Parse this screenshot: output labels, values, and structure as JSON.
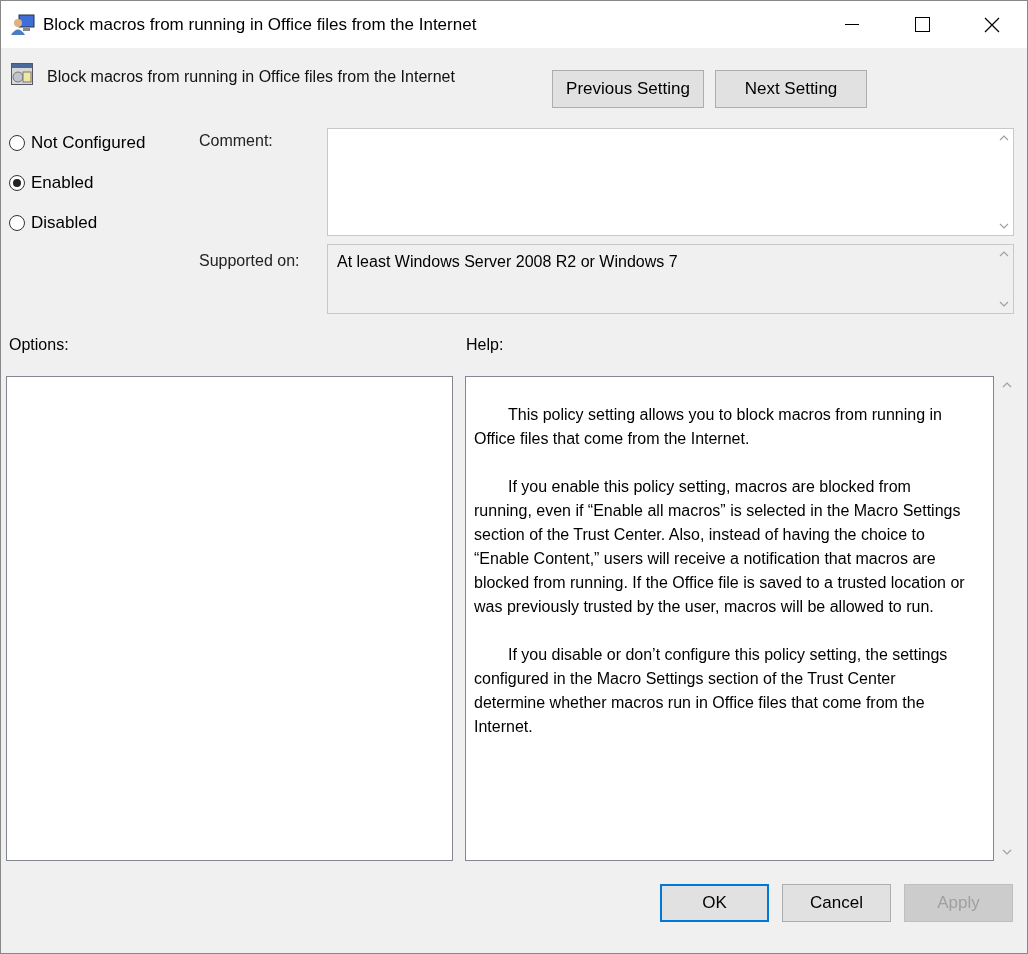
{
  "window": {
    "title": "Block macros from running in Office files from the Internet"
  },
  "policy": {
    "title": "Block macros from running in Office files from the Internet"
  },
  "nav_buttons": [
    {
      "label": "Previous Setting"
    },
    {
      "label": "Next Setting"
    }
  ],
  "state_options": [
    {
      "label": "Not Configured",
      "selected": false
    },
    {
      "label": "Enabled",
      "selected": true
    },
    {
      "label": "Disabled",
      "selected": false
    }
  ],
  "comment": {
    "label": "Comment:"
  },
  "supported_on": {
    "label": "Supported on:",
    "value": "At least Windows Server 2008 R2 or Windows 7"
  },
  "options": {
    "label": "Options:"
  },
  "help": {
    "label": "Help:",
    "paragraphs": [
      "This policy setting allows you to block macros from running in Office files that come from the Internet.",
      "If you enable this policy setting, macros are blocked from running, even if “Enable all macros” is selected in the Macro Settings section of the Trust Center. Also, instead of having the choice to “Enable Content,” users will receive a notification that macros are blocked from running. If the Office file is saved to a trusted location or was previously trusted by the user, macros will be allowed to run.",
      "If you disable or don’t configure this policy setting, the settings configured in the Macro Settings section of the Trust Center determine whether macros run in Office files that come from the Internet."
    ]
  },
  "buttons": [
    {
      "label": "OK",
      "default": true,
      "disabled": false
    },
    {
      "label": "Cancel",
      "default": false,
      "disabled": false
    },
    {
      "label": "Apply",
      "default": false,
      "disabled": true
    }
  ]
}
